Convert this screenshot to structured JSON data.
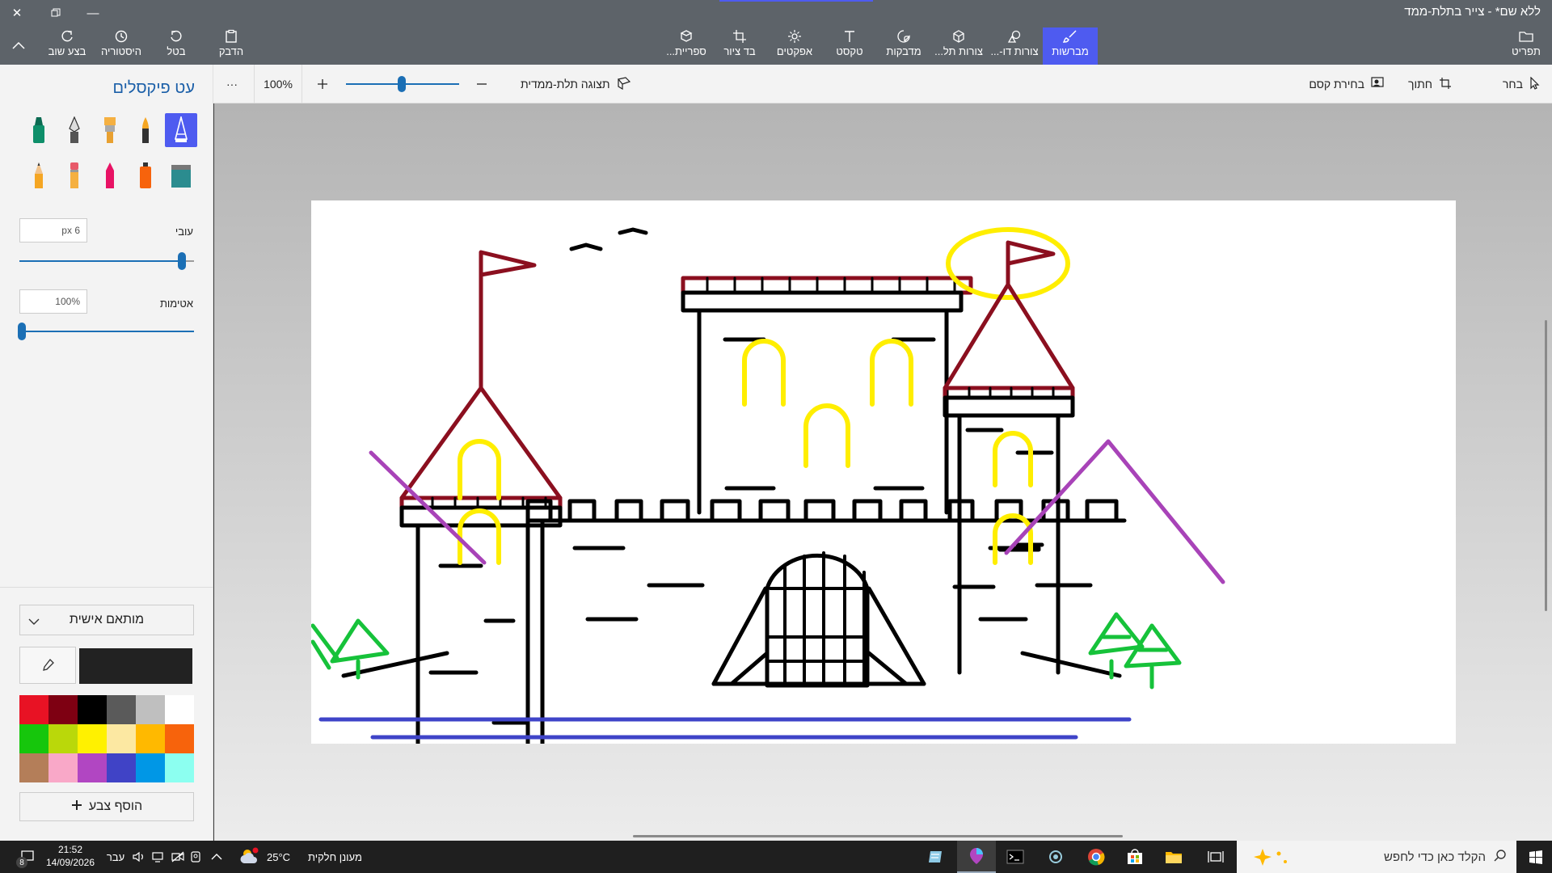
{
  "window": {
    "title": "ללא שם* - צייר בתלת-ממד"
  },
  "ribbon": {
    "right": [
      {
        "label": "תפריט",
        "icon": "folder-icon"
      }
    ],
    "tabs": [
      {
        "label": "מברשות",
        "icon": "brush-icon",
        "active": true
      },
      {
        "label": "צורות דו-...",
        "icon": "2d-shapes-icon"
      },
      {
        "label": "צורות תל...",
        "icon": "3d-shapes-icon"
      },
      {
        "label": "מדבקות",
        "icon": "sticker-icon"
      },
      {
        "label": "טקסט",
        "icon": "text-icon"
      },
      {
        "label": "אפקטים",
        "icon": "effects-icon"
      },
      {
        "label": "בד ציור",
        "icon": "canvas-crop-icon"
      },
      {
        "label": "ספריית...",
        "icon": "library-icon"
      }
    ],
    "left": [
      {
        "label": "הדבק",
        "icon": "paste-icon"
      },
      {
        "label": "בטל",
        "icon": "undo-icon"
      },
      {
        "label": "היסטוריה",
        "icon": "history-icon"
      },
      {
        "label": "בצע שוב",
        "icon": "redo-icon"
      }
    ]
  },
  "toolbar": {
    "select": "בחר",
    "crop": "חתוך",
    "magic_select": "בחירת קסם",
    "view_3d": "תצוגה תלת-ממדית",
    "zoom_value": "100%",
    "more": "···"
  },
  "panel": {
    "title": "עט פיקסלים",
    "brushes": [
      {
        "name": "pixel-pen",
        "selected": true
      },
      {
        "name": "calligraphy-pen"
      },
      {
        "name": "oil-brush"
      },
      {
        "name": "ink-pen"
      },
      {
        "name": "marker"
      },
      {
        "name": "watercolor"
      },
      {
        "name": "spray-can"
      },
      {
        "name": "crayon"
      },
      {
        "name": "eraser-pencil"
      },
      {
        "name": "pencil"
      }
    ],
    "thickness_label": "עובי",
    "thickness_value": "6 px",
    "thickness_level": 0.94,
    "opacity_label": "אטימות",
    "opacity_value": "100%",
    "opacity_level": 0.0,
    "custom_label": "מותאם אישית",
    "current_color": "#222222",
    "palette": [
      "#e81224",
      "#7e0012",
      "#000000",
      "#5a5a5a",
      "#bfbfbf",
      "#ffffff",
      "#16c60c",
      "#bad80a",
      "#fff100",
      "#fce8a2",
      "#ffb900",
      "#f7630c",
      "#b47e59",
      "#f9a8c8",
      "#b146c2",
      "#4043c6",
      "#0097e6",
      "#8cfff0"
    ],
    "add_color": "הוסף צבע"
  },
  "taskbar": {
    "search_placeholder": "הקלד כאן כדי לחפש",
    "weather_temp": "25°C",
    "weather_text": "מעונן חלקית",
    "lang": "עבר",
    "time": "21:52",
    "date": "14/09/2026",
    "notifications": "8"
  },
  "colors": {
    "accent": "#4e5bf0",
    "castle_red": "#8b0f1f",
    "yellow": "#ffee00",
    "purple": "#a843b8",
    "green": "#16c23a",
    "blue": "#3f44c8"
  }
}
